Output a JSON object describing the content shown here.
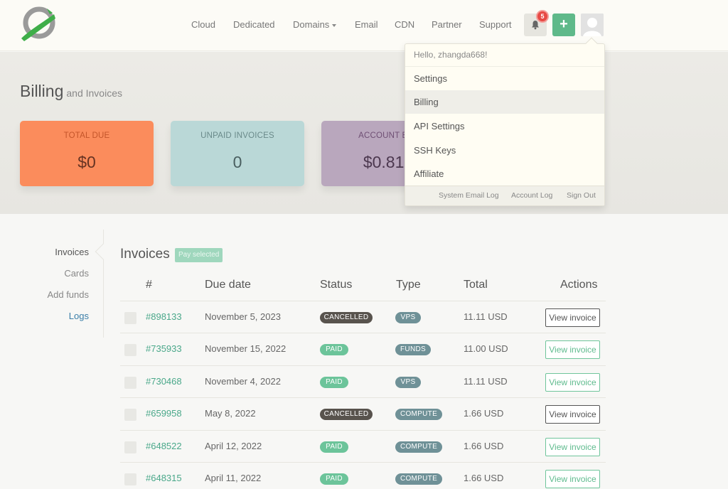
{
  "nav": {
    "items": [
      "Cloud",
      "Dedicated",
      "Domains",
      "Email",
      "CDN",
      "Partner",
      "Support"
    ],
    "notification_count": "5",
    "plus_label": "+"
  },
  "billing": {
    "title": "Billing",
    "subtitle": "and Invoices",
    "stats": [
      {
        "label": "TOTAL DUE",
        "value": "$0"
      },
      {
        "label": "UNPAID INVOICES",
        "value": "0"
      },
      {
        "label": "ACCOUNT BAL",
        "value": "$0.810"
      }
    ]
  },
  "dropdown": {
    "greeting": "Hello, zhangda668!",
    "items": [
      "Settings",
      "Billing",
      "API Settings",
      "SSH Keys",
      "Affiliate"
    ],
    "active": "Billing",
    "footer": [
      "System Email Log",
      "Account Log",
      "Sign Out"
    ]
  },
  "sidenav": {
    "items": [
      "Invoices",
      "Cards",
      "Add funds",
      "Logs"
    ]
  },
  "invoices": {
    "title": "Invoices",
    "pay_selected": "Pay selected",
    "headers": [
      "#",
      "Due date",
      "Status",
      "Type",
      "Total",
      "Actions"
    ],
    "view_label": "View invoice",
    "rows": [
      {
        "id": "#898133",
        "due": "November 5, 2023",
        "status": "CANCELLED",
        "type": "VPS",
        "total": "11.11 USD"
      },
      {
        "id": "#735933",
        "due": "November 15, 2022",
        "status": "PAID",
        "type": "FUNDS",
        "total": "11.00 USD"
      },
      {
        "id": "#730468",
        "due": "November 4, 2022",
        "status": "PAID",
        "type": "VPS",
        "total": "11.11 USD"
      },
      {
        "id": "#659958",
        "due": "May 8, 2022",
        "status": "CANCELLED",
        "type": "COMPUTE",
        "total": "1.66 USD"
      },
      {
        "id": "#648522",
        "due": "April 12, 2022",
        "status": "PAID",
        "type": "COMPUTE",
        "total": "1.66 USD"
      },
      {
        "id": "#648315",
        "due": "April 11, 2022",
        "status": "PAID",
        "type": "COMPUTE",
        "total": "1.66 USD"
      }
    ]
  },
  "colors": {
    "accent_green": "#5fb98a",
    "paid": "#6cc49a",
    "cancelled": "#58534d",
    "type_pill": "#6f9197",
    "link_blue": "#3a7ea8"
  }
}
